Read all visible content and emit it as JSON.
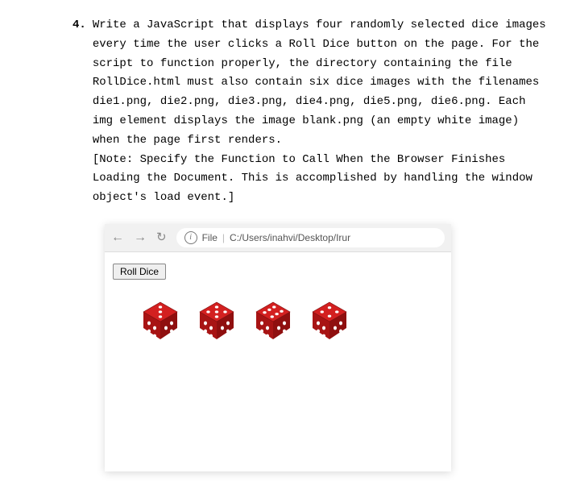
{
  "question": {
    "number": "4.",
    "body": "Write a JavaScript that displays four randomly selected dice images every time the user clicks a Roll Dice button on the page. For the script to function properly, the directory containing the file RollDice.html must also contain six dice images with the filenames die1.png, die2.png, die3.png, die4.png, die5.png, die6.png. Each img element displays the image blank.png (an empty white image) when the page first renders.",
    "note": "[Note: Specify the Function to Call When the Browser Finishes Loading the Document. This is accomplished by handling the window object's load event.]"
  },
  "browser": {
    "url_prefix": "File",
    "url_path": "C:/Users/inahvi/Desktop/Irur"
  },
  "page": {
    "button_label": "Roll Dice"
  },
  "dice": {
    "color": "#d32020",
    "values": [
      3,
      5,
      6,
      4
    ]
  }
}
